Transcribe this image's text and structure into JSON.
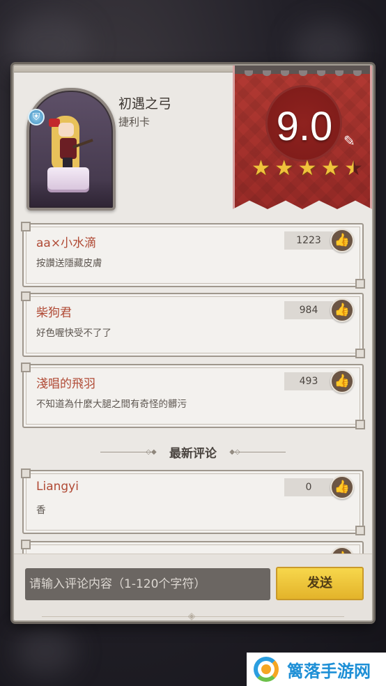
{
  "hero": {
    "title": "初遇之弓",
    "subtitle": "捷利卡",
    "class_icon": "shield-icon"
  },
  "rating": {
    "score": "9.0",
    "stars_value": 4.5,
    "stars_max": 5,
    "edit_icon": "pencil-icon"
  },
  "top_comments": [
    {
      "user": "aa×小水滴",
      "text": "按讚送隱藏皮膚",
      "likes": "1223"
    },
    {
      "user": "柴狗君",
      "text": "好色喔快受不了了",
      "likes": "984"
    },
    {
      "user": "淺唱的飛羽",
      "text": "不知道為什麼大腿之間有奇怪的髒污",
      "likes": "493"
    }
  ],
  "latest_section": {
    "title": "最新评论"
  },
  "latest_comments": [
    {
      "user": "Liangyi",
      "text": "香",
      "likes": "0"
    }
  ],
  "composer": {
    "placeholder": "请输入评论内容（1-120个字符）",
    "send_label": "发送"
  },
  "watermark": {
    "text": "篱落手游网"
  },
  "colors": {
    "accent_red": "#b33a33",
    "username": "#b04a35",
    "send_button": "#f0c840",
    "star": "#f0c23c"
  }
}
